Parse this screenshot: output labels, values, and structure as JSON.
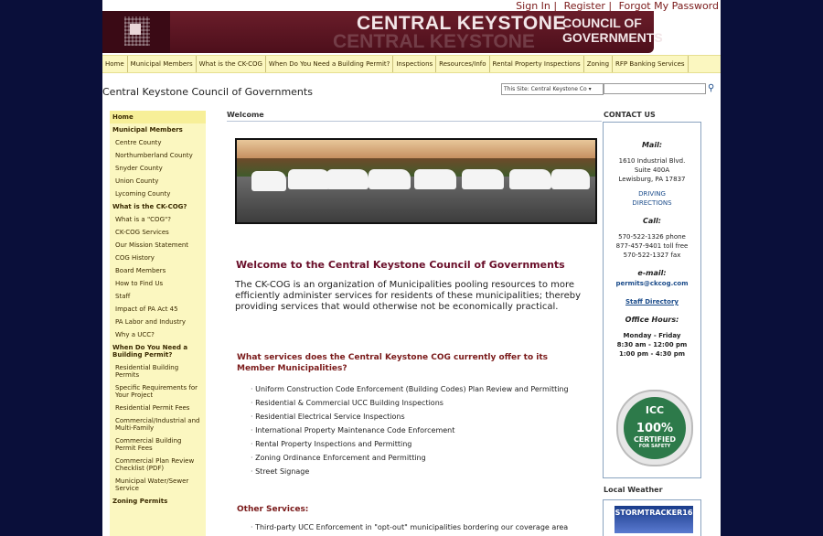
{
  "top_links": [
    "Sign In",
    "Register",
    "Forgot My Password"
  ],
  "banner": {
    "title": "CENTRAL KEYSTONE",
    "subtitle": "COUNCIL OF GOVERNMENTS"
  },
  "nav": [
    "Home",
    "Municipal Members",
    "What is the CK-COG",
    "When Do You Need a Building Permit?",
    "Inspections",
    "Resources/Info",
    "Rental Property Inspections",
    "Zoning",
    "RFP Banking Services"
  ],
  "site_title": "Central Keystone Council of Governments",
  "search": {
    "scope": "This Site: Central Keystone Co"
  },
  "leftnav": [
    {
      "label": "Home",
      "kind": "home"
    },
    {
      "label": "Municipal Members",
      "kind": "head"
    },
    {
      "label": "Centre County",
      "kind": "item"
    },
    {
      "label": "Northumberland County",
      "kind": "item"
    },
    {
      "label": "Snyder County",
      "kind": "item"
    },
    {
      "label": "Union County",
      "kind": "item"
    },
    {
      "label": "Lycoming County",
      "kind": "item"
    },
    {
      "label": "What is the CK-COG?",
      "kind": "head"
    },
    {
      "label": "What is a \"COG\"?",
      "kind": "item"
    },
    {
      "label": "CK-COG Services",
      "kind": "item"
    },
    {
      "label": "Our Mission Statement",
      "kind": "item"
    },
    {
      "label": "COG History",
      "kind": "item"
    },
    {
      "label": "Board Members",
      "kind": "item"
    },
    {
      "label": "How to Find Us",
      "kind": "item"
    },
    {
      "label": "Staff",
      "kind": "item"
    },
    {
      "label": "Impact of PA Act 45",
      "kind": "item"
    },
    {
      "label": "PA Labor and Industry",
      "kind": "item"
    },
    {
      "label": "Why a UCC?",
      "kind": "item"
    },
    {
      "label": "When Do You Need a Building Permit?",
      "kind": "head"
    },
    {
      "label": "Residential Building Permits",
      "kind": "item"
    },
    {
      "label": "Specific Requirements for Your Project",
      "kind": "item"
    },
    {
      "label": "Residential Permit Fees",
      "kind": "item"
    },
    {
      "label": "Commercial/Industrial and Multi-Family",
      "kind": "item"
    },
    {
      "label": "Commercial Building Permit Fees",
      "kind": "item"
    },
    {
      "label": "Commercial Plan Review Checklist (PDF)",
      "kind": "item"
    },
    {
      "label": "Municipal Water/Sewer Service",
      "kind": "item"
    },
    {
      "label": "Zoning Permits",
      "kind": "head"
    }
  ],
  "welcome": {
    "section_label": "Welcome",
    "heading": "Welcome to the Central Keystone Council of Governments",
    "intro": "The CK-COG is an organization of Municipalities pooling resources to more efficiently administer services for residents of these municipalities; thereby providing services that would otherwise not be economically practical."
  },
  "services": {
    "question": "What services does the Central Keystone COG currently offer to its Member Municipalities?",
    "items": [
      "Uniform Construction Code Enforcement (Building Codes) Plan Review and Permitting",
      "Residential & Commercial UCC Building Inspections",
      "Residential Electrical Service Inspections",
      "International Property Maintenance Code Enforcement",
      "Rental Property Inspections and Permitting",
      "Zoning Ordinance Enforcement and Permitting",
      "Street Signage"
    ]
  },
  "other": {
    "heading": "Other Services:",
    "items": [
      "Third-party UCC Enforcement in \"opt-out\" municipalities bordering our coverage area"
    ]
  },
  "contact": {
    "heading": "CONTACT US",
    "mail_label": "Mail:",
    "address": [
      "1610 Industrial Blvd.",
      "Suite 400A",
      "Lewisburg, PA  17837"
    ],
    "directions": "DRIVING DIRECTIONS",
    "call_label": "Call:",
    "phones": [
      "570-522-1326 phone",
      "877-457-9401 toll free",
      "570-522-1327 fax"
    ],
    "email_label": "e-mail:",
    "email": "permits@ckcog.com",
    "staff_link": "Staff Directory",
    "hours_label": "Office Hours:",
    "hours": [
      "Monday - Friday",
      "8:30 am - 12:00 pm",
      "1:00 pm - 4:30 pm"
    ]
  },
  "icc_badge": {
    "top": "ICC",
    "pct": "100%",
    "certified": "CERTIFIED",
    "safety": "FOR SAFETY"
  },
  "weather": {
    "heading": "Local Weather",
    "brand": "STORMTRACKER16"
  }
}
